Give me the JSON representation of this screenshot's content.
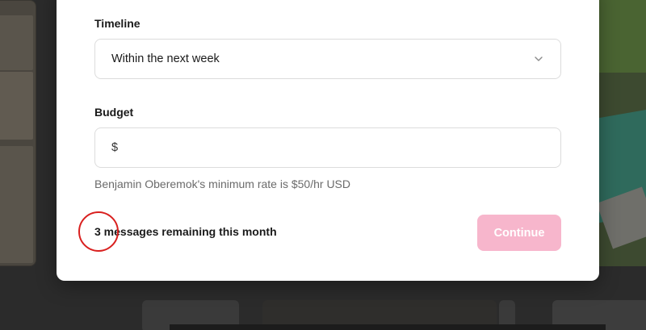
{
  "form": {
    "timeline": {
      "label": "Timeline",
      "selected_value": "Within the next week"
    },
    "budget": {
      "label": "Budget",
      "currency_symbol": "$",
      "value": "",
      "helper_text": "Benjamin Oberemok's minimum rate is $50/hr USD"
    },
    "messages_remaining_text": "3 messages remaining this month",
    "continue_label": "Continue"
  },
  "colors": {
    "continue_button_disabled": "#f7b6cc",
    "annotation_circle": "#d9201f",
    "overlay_background": "#2b2b2b"
  },
  "icons": {
    "timeline_dropdown": "chevron-down-icon"
  }
}
